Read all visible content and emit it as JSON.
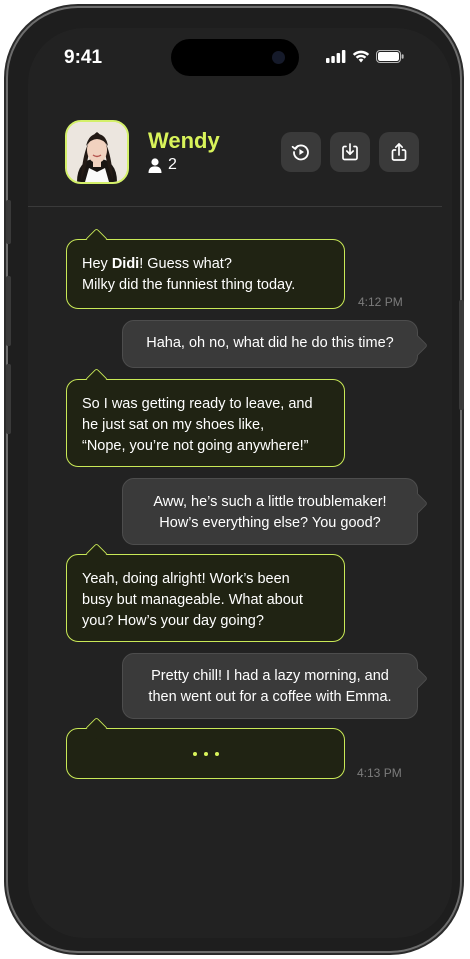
{
  "status_bar": {
    "time": "9:41"
  },
  "header": {
    "name": "Wendy",
    "member_count": "2"
  },
  "header_buttons": [
    {
      "icon": "replay-icon"
    },
    {
      "icon": "download-icon"
    },
    {
      "icon": "share-icon"
    }
  ],
  "messages": [
    {
      "side": "left",
      "parts": [
        "Hey ",
        "Didi",
        "! Guess what?"
      ],
      "line2": "Milky did the funniest thing today.",
      "time": "4:12 PM"
    },
    {
      "side": "right",
      "text": "Haha, oh no, what did he do this time?"
    },
    {
      "side": "left",
      "lines": [
        "So I was getting ready to leave, and",
        "he just sat on my shoes like,",
        "“Nope, you’re not going anywhere!”"
      ]
    },
    {
      "side": "right",
      "lines": [
        "Aww, he’s such a little troublemaker!",
        "How’s everything else? You good?"
      ]
    },
    {
      "side": "left",
      "lines": [
        "Yeah, doing alright! Work’s been",
        "busy but manageable. What about",
        "you? How’s your day going?"
      ]
    },
    {
      "side": "right",
      "lines": [
        "Pretty chill! I had a lazy morning, and",
        "then went out for a coffee with Emma."
      ]
    },
    {
      "side": "left",
      "typing": true,
      "time": "4:13 PM"
    }
  ],
  "colors": {
    "accent": "#d8f35a",
    "background": "#222222",
    "bubble_right": "#3a3a3a"
  }
}
